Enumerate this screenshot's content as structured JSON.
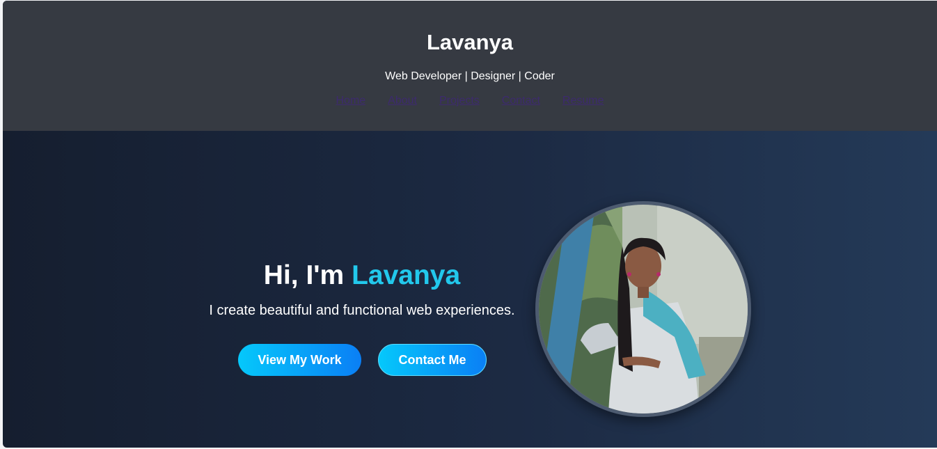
{
  "header": {
    "title": "Lavanya",
    "tagline": "Web Developer | Designer | Coder",
    "nav": [
      "Home",
      "About",
      "Projects",
      "Contact",
      "Resume"
    ]
  },
  "hero": {
    "greeting": "Hi, I'm",
    "name": "Lavanya",
    "subtitle": "I create beautiful and functional web experiences.",
    "primary_button": "View My Work",
    "secondary_button": "Contact Me"
  },
  "colors": {
    "header_bg": "#363a42",
    "accent": "#22c8ec",
    "button_gradient_start": "#05c8fb",
    "button_gradient_end": "#0a7ff5",
    "nav_link": "#3d2a6e"
  }
}
